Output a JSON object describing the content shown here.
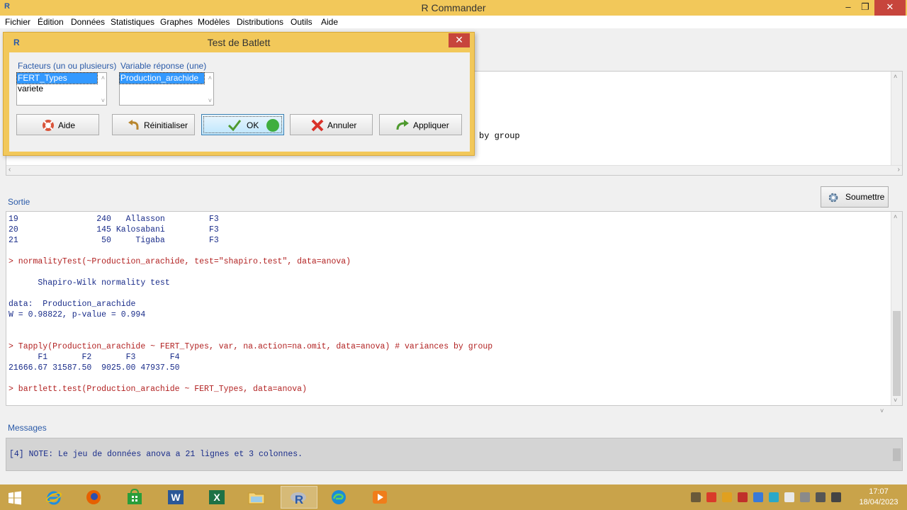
{
  "window": {
    "title": "R Commander",
    "app_icon_letter": "R",
    "minimize_glyph": "–",
    "maximize_glyph": "❐",
    "close_glyph": "✕"
  },
  "menu": [
    "Fichier",
    "Édition",
    "Données",
    "Statistiques",
    "Graphes",
    "Modèles",
    "Distributions",
    "Outils",
    "Aide"
  ],
  "script": {
    "visible_fragment": "by group"
  },
  "labels": {
    "output": "Sortie",
    "messages": "Messages"
  },
  "submit_button": "Soumettre",
  "output_lines": [
    {
      "kind": "res",
      "text": "19                240   Allasson         F3"
    },
    {
      "kind": "res",
      "text": "20                145 Kalosabani         F3"
    },
    {
      "kind": "res",
      "text": "21                 50     Tigaba         F3"
    },
    {
      "kind": "res",
      "text": ""
    },
    {
      "kind": "cmd",
      "text": "> normalityTest(~Production_arachide, test=\"shapiro.test\", data=anova)"
    },
    {
      "kind": "res",
      "text": ""
    },
    {
      "kind": "res",
      "text": "      Shapiro-Wilk normality test"
    },
    {
      "kind": "res",
      "text": ""
    },
    {
      "kind": "res",
      "text": "data:  Production_arachide"
    },
    {
      "kind": "res",
      "text": "W = 0.98822, p-value = 0.994"
    },
    {
      "kind": "res",
      "text": ""
    },
    {
      "kind": "res",
      "text": ""
    },
    {
      "kind": "cmd",
      "text": "> Tapply(Production_arachide ~ FERT_Types, var, na.action=na.omit, data=anova) # variances by group"
    },
    {
      "kind": "res",
      "text": "      F1       F2       F3       F4"
    },
    {
      "kind": "res",
      "text": "21666.67 31587.50  9025.00 47937.50"
    },
    {
      "kind": "res",
      "text": ""
    },
    {
      "kind": "cmd",
      "text": "> bartlett.test(Production_arachide ~ FERT_Types, data=anova)"
    }
  ],
  "message_text": "[4] NOTE: Le jeu de données anova a 21 lignes et 3 colonnes.",
  "dialog": {
    "title": "Test de Batlett",
    "icon_letter": "R",
    "close_glyph": "✕",
    "factors_label": "Facteurs (un ou plusieurs)",
    "factors": [
      "FERT_Types",
      "variete"
    ],
    "factors_selected": 0,
    "response_label": "Variable réponse (une)",
    "responses": [
      "Production_arachide"
    ],
    "responses_selected": 0,
    "buttons": {
      "help": "Aide",
      "reset": "Réinitialiser",
      "ok": "OK",
      "cancel": "Annuler",
      "apply": "Appliquer"
    }
  },
  "taskbar": {
    "apps": [
      "windows-start",
      "internet-explorer",
      "firefox",
      "store",
      "word",
      "excel",
      "file-explorer",
      "r-commander",
      "edge",
      "media-player"
    ],
    "active_app": "r-commander",
    "time": "17:07",
    "date": "18/04/2023"
  },
  "colors": {
    "title_bar": "#f2c85a",
    "taskbar": "#c9a34a",
    "command_text": "#b22222",
    "result_text": "#1a2d8a",
    "label_text": "#2a5aa8"
  }
}
